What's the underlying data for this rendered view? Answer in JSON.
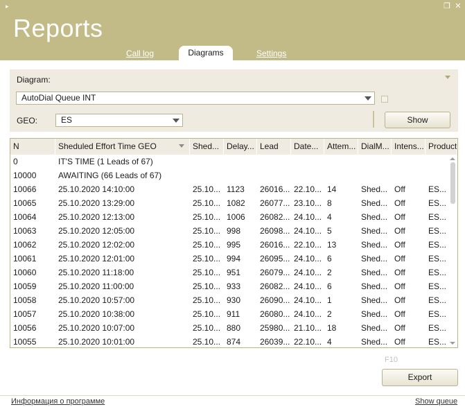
{
  "window": {
    "title": "Reports",
    "menu_glyph": "▸",
    "restore_glyph": "❐",
    "close_glyph": "✕"
  },
  "tabs": [
    {
      "label": "Call log",
      "active": false
    },
    {
      "label": "Diagrams",
      "active": true
    },
    {
      "label": "Settings",
      "active": false
    }
  ],
  "filters": {
    "diagram_label": "Diagram:",
    "diagram_value": "AutoDial Queue INT",
    "geo_label": "GEO:",
    "geo_value": "ES",
    "show_button": "Show"
  },
  "table": {
    "columns": [
      "N",
      "Sheduled Effort Time GEO",
      "Shed...",
      "Delay...",
      "Lead",
      "Date...",
      "Attem...",
      "DialM...",
      "Intens...",
      "Product"
    ],
    "group_rows": [
      {
        "n": "0",
        "text": "IT'S TIME (1 Leads of 67)"
      },
      {
        "n": "10000",
        "text": "AWAITING (66 Leads of 67)"
      }
    ],
    "rows": [
      [
        "10066",
        "25.10.2020 14:10:00",
        "25.10...",
        "1123",
        "26016...",
        "22.10...",
        "14",
        "Shed...",
        "Off",
        "ES..."
      ],
      [
        "10065",
        "25.10.2020 13:29:00",
        "25.10...",
        "1082",
        "26077...",
        "23.10...",
        "8",
        "Shed...",
        "Off",
        "ES..."
      ],
      [
        "10064",
        "25.10.2020 12:13:00",
        "25.10...",
        "1006",
        "26082...",
        "24.10...",
        "4",
        "Shed...",
        "Off",
        "ES..."
      ],
      [
        "10063",
        "25.10.2020 12:05:00",
        "25.10...",
        "998",
        "26098...",
        "24.10...",
        "5",
        "Shed...",
        "Off",
        "ES..."
      ],
      [
        "10062",
        "25.10.2020 12:02:00",
        "25.10...",
        "995",
        "26016...",
        "22.10...",
        "13",
        "Shed...",
        "Off",
        "ES..."
      ],
      [
        "10061",
        "25.10.2020 12:01:00",
        "25.10...",
        "994",
        "26095...",
        "24.10...",
        "6",
        "Shed...",
        "Off",
        "ES..."
      ],
      [
        "10060",
        "25.10.2020 11:18:00",
        "25.10...",
        "951",
        "26079...",
        "24.10...",
        "2",
        "Shed...",
        "Off",
        "ES..."
      ],
      [
        "10059",
        "25.10.2020 11:00:00",
        "25.10...",
        "933",
        "26082...",
        "24.10...",
        "6",
        "Shed...",
        "Off",
        "ES..."
      ],
      [
        "10058",
        "25.10.2020 10:57:00",
        "25.10...",
        "930",
        "26090...",
        "24.10...",
        "1",
        "Shed...",
        "Off",
        "ES..."
      ],
      [
        "10057",
        "25.10.2020 10:38:00",
        "25.10...",
        "911",
        "26080...",
        "24.10...",
        "2",
        "Shed...",
        "Off",
        "ES..."
      ],
      [
        "10056",
        "25.10.2020 10:07:00",
        "25.10...",
        "880",
        "25980...",
        "21.10...",
        "18",
        "Shed...",
        "Off",
        "ES..."
      ],
      [
        "10055",
        "25.10.2020 10:01:00",
        "25.10...",
        "874",
        "26039...",
        "22.10...",
        "4",
        "Shed...",
        "Off",
        "ES..."
      ]
    ]
  },
  "bottom": {
    "hotkey": "F10",
    "export_button": "Export",
    "about_link": "Информация о программе",
    "queue_link": "Show queue"
  },
  "colors": {
    "header_bg": "#c2bb87",
    "panel_bg": "#efebe0",
    "border": "#b9b38c"
  }
}
